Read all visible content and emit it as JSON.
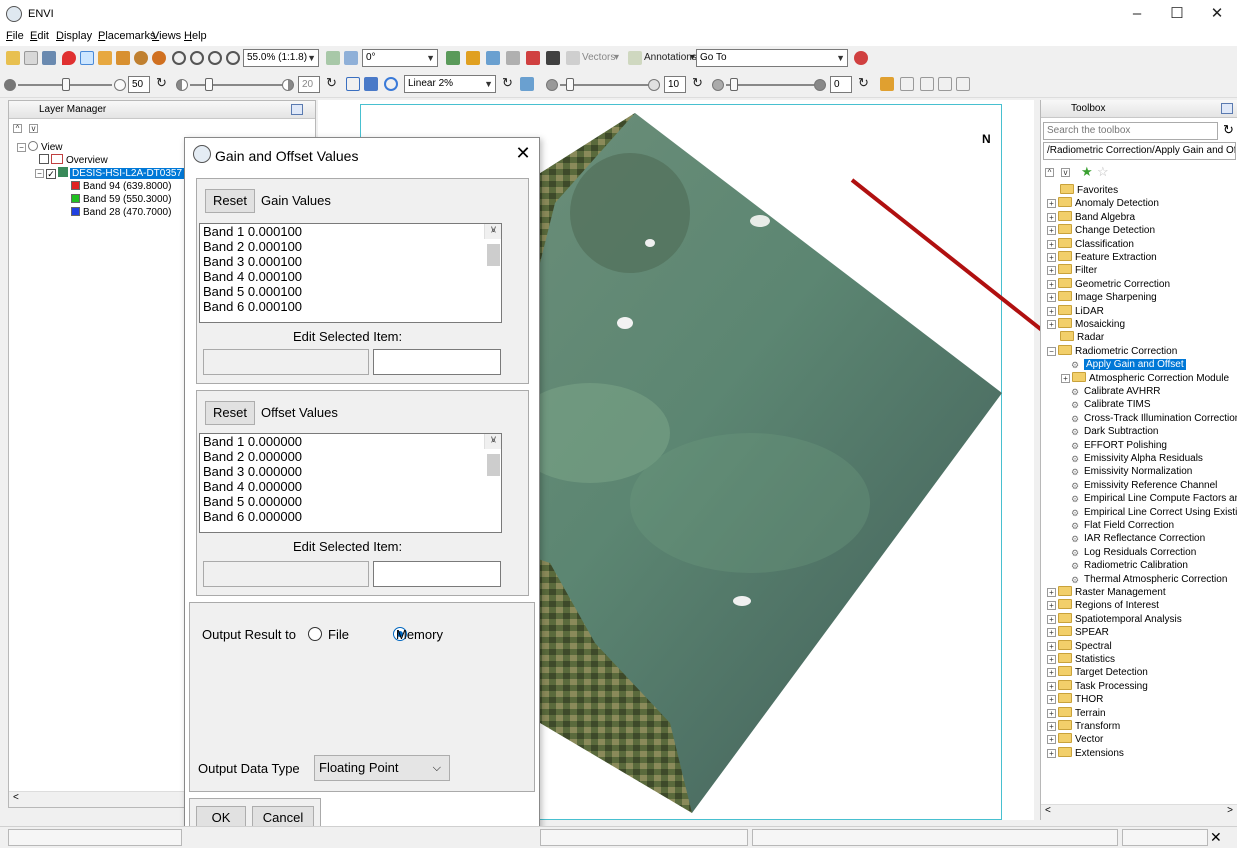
{
  "window": {
    "title": "ENVI",
    "minimize": "–",
    "maximize": "☐",
    "close": "✕"
  },
  "menu": [
    "File",
    "Edit",
    "Display",
    "Placemarks",
    "Views",
    "Help"
  ],
  "toolbar": {
    "zoom": "55.0% (1:1.8)",
    "rotation": "0°",
    "vectors": "Vectors",
    "annotations": "Annotations",
    "goto": "Go To",
    "brightness": "50",
    "contrast": "20",
    "stretch": "Linear 2%",
    "sharpen": "10",
    "transparency": "0"
  },
  "layer_manager": {
    "title": "Layer Manager",
    "view": "View",
    "overview": "Overview",
    "raster": "DESIS-HSI-L2A-DT0357",
    "bands": [
      {
        "label": "Band 94 (639.8000)",
        "color": "#e02020"
      },
      {
        "label": "Band 59 (550.3000)",
        "color": "#20c020"
      },
      {
        "label": "Band 28 (470.7000)",
        "color": "#2040e0"
      }
    ]
  },
  "north": "N",
  "dialog": {
    "title": "Gain and Offset Values",
    "close": "✕",
    "reset": "Reset",
    "gain_label": "Gain Values",
    "gain_items": [
      "Band 1 0.000100",
      "Band 2 0.000100",
      "Band 3 0.000100",
      "Band 4 0.000100",
      "Band 5 0.000100",
      "Band 6 0.000100"
    ],
    "edit_label": "Edit Selected Item:",
    "offset_label": "Offset Values",
    "offset_items": [
      "Band 1 0.000000",
      "Band 2 0.000000",
      "Band 3 0.000000",
      "Band 4 0.000000",
      "Band 5 0.000000",
      "Band 6 0.000000"
    ],
    "output_to": "Output Result to",
    "opt_file": "File",
    "opt_memory": "Memory",
    "output_type_label": "Output Data Type",
    "output_type": "Floating Point",
    "ok": "OK",
    "cancel": "Cancel"
  },
  "toolbox": {
    "title": "Toolbox",
    "search_placeholder": "Search the toolbox",
    "path": "/Radiometric Correction/Apply Gain and Offset",
    "items_before": [
      "Favorites",
      "Anomaly Detection",
      "Band Algebra",
      "Change Detection",
      "Classification",
      "Feature Extraction",
      "Filter",
      "Geometric Correction",
      "Image Sharpening",
      "LiDAR",
      "Mosaicking",
      "Radar",
      "Radiometric Correction"
    ],
    "radiometric_children": [
      "Apply Gain and Offset",
      "Atmospheric Correction Module",
      "Calibrate AVHRR",
      "Calibrate TIMS",
      "Cross-Track Illumination Correction",
      "Dark Subtraction",
      "EFFORT Polishing",
      "Emissivity Alpha Residuals",
      "Emissivity Normalization",
      "Emissivity Reference Channel",
      "Empirical Line Compute Factors and",
      "Empirical Line Correct Using Existing",
      "Flat Field Correction",
      "IAR Reflectance Correction",
      "Log Residuals Correction",
      "Radiometric Calibration",
      "Thermal Atmospheric Correction"
    ],
    "items_after": [
      "Raster Management",
      "Regions of Interest",
      "Spatiotemporal Analysis",
      "SPEAR",
      "Spectral",
      "Statistics",
      "Target Detection",
      "Task Processing",
      "THOR",
      "Terrain",
      "Transform",
      "Vector",
      "Extensions"
    ]
  },
  "colors": {
    "selection": "#0078d7",
    "arrow": "#b01010",
    "frame": "#48c0d0"
  }
}
